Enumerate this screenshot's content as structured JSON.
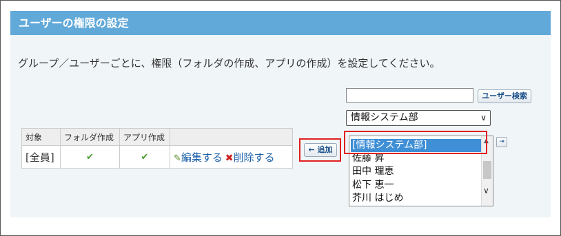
{
  "header": {
    "title": "ユーザーの権限の設定"
  },
  "description": "グループ／ユーザーごとに、権限（フォルダの作成、アプリの作成）を設定してください。",
  "permission_table": {
    "columns": [
      "対象",
      "フォルダ作成",
      "アプリ作成",
      ""
    ],
    "rows": [
      {
        "target": "[全員]",
        "folder_create": "✔",
        "app_create": "✔",
        "edit_label": "編集する",
        "delete_label": "削除する"
      }
    ]
  },
  "add_button": {
    "label": "← 追加"
  },
  "search": {
    "value": "",
    "button_label": "ユーザー検索"
  },
  "group_select": {
    "selected": "情報システム部"
  },
  "listbox": {
    "items": [
      "[情報システム部]",
      "佐藤 昇",
      "田中 理恵",
      "松下 恵一",
      "芥川 はじめ"
    ],
    "selected_index": 0
  },
  "icons": {
    "check": "check-icon",
    "edit": "pencil-icon",
    "delete": "cross-icon",
    "detail": "arrow-right-icon"
  },
  "colors": {
    "header": "#61a9d8",
    "panel": "#f0f5f8",
    "highlight": "#e02020",
    "selection": "#3f8fd6",
    "link": "#1a5fa8"
  }
}
